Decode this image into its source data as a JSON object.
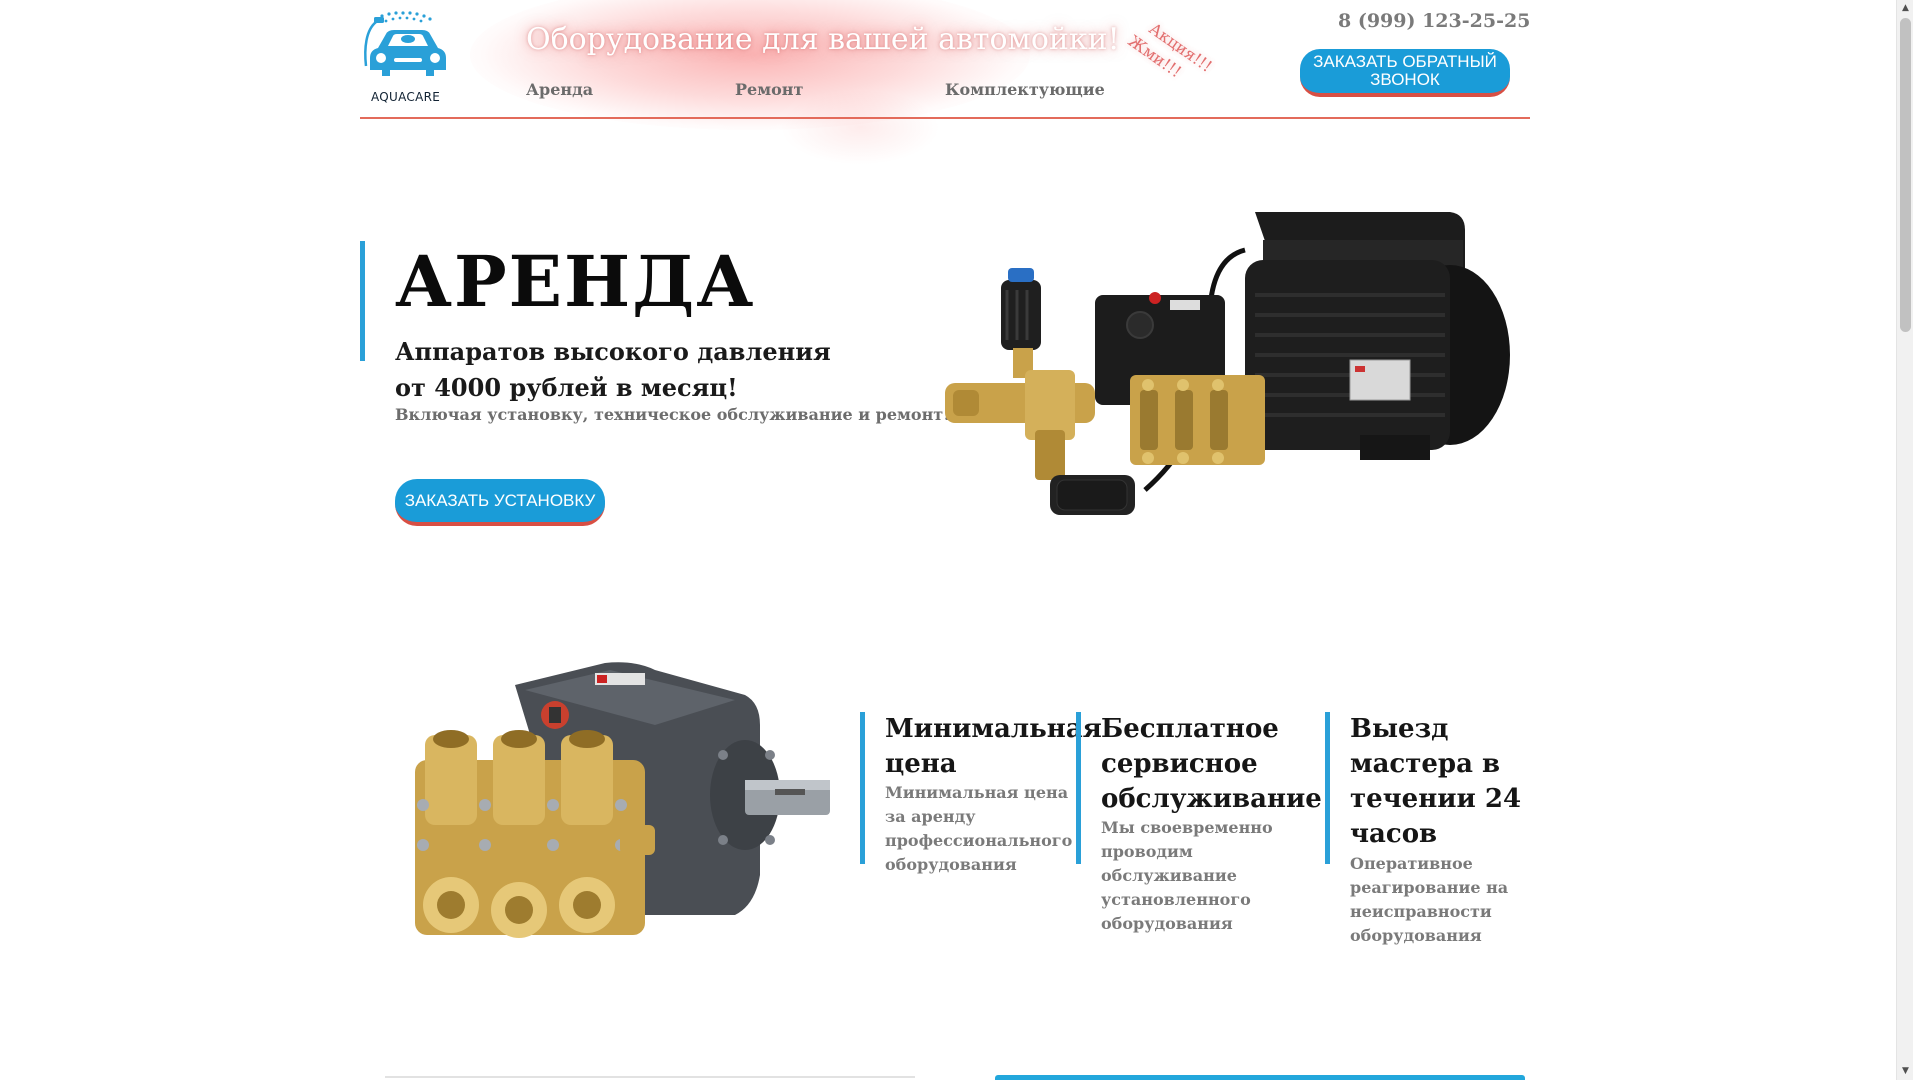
{
  "header": {
    "logo_text": "AQUACARE",
    "tagline": "Оборудование для вашей автомойки!",
    "nav": [
      "Аренда",
      "Ремонт",
      "Комплектующие"
    ],
    "promo": [
      "Акция!!!",
      "Жми!!!"
    ],
    "phone": "8 (999) 123-25-25",
    "callback_button": "ЗАКАЗАТЬ ОБРАТНЫЙ ЗВОНОК"
  },
  "hero": {
    "title": "АРЕНДА",
    "subtitle_line1": "Аппаратов высокого давления",
    "subtitle_line2": "от 4000 рублей в месяц!",
    "note": "Включая установку, техническое обслуживание и ремонт!",
    "order_button": "ЗАКАЗАТЬ УСТАНОВКУ"
  },
  "features": [
    {
      "title": "Минимальная цена",
      "text": "Минимальная цена за аренду профессионального оборудования"
    },
    {
      "title": "Бесплатное сервисное обслуживание",
      "text": "Мы своевременно проводим обслуживание установленного оборудования"
    },
    {
      "title": "Выезд мастера в течении 24 часов",
      "text": "Оперативное реагирование на неисправности оборудования"
    }
  ],
  "colors": {
    "accent_blue": "#1a9cd8",
    "accent_red": "#d84f44",
    "brass": "#c9a24a"
  },
  "icons": [
    "aquacare-logo-icon",
    "pressure-washer-machine-image",
    "triplex-pump-image"
  ]
}
